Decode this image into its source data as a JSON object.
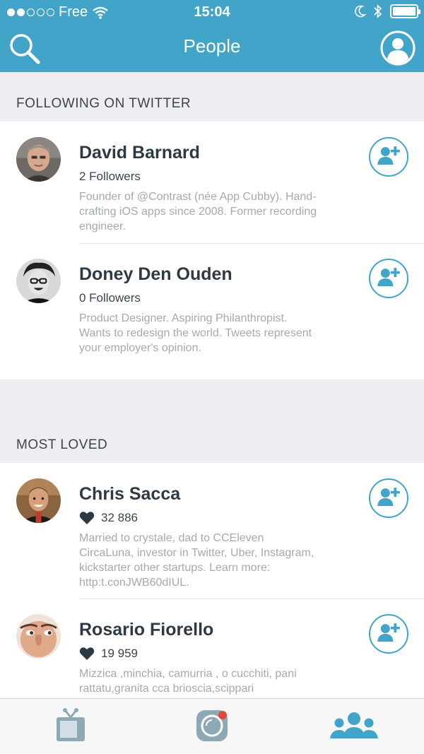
{
  "status_bar": {
    "carrier": "Free",
    "time": "15:04",
    "battery_level": 1.0
  },
  "nav": {
    "title": "People",
    "search_icon": "search-icon",
    "profile_icon": "profile-icon"
  },
  "colors": {
    "accent": "#42a4c8",
    "text_dark": "#2d3a44",
    "text_muted": "#a3aab1",
    "section_bg": "#eeeef2"
  },
  "sections": [
    {
      "title": "FOLLOWING ON TWITTER"
    },
    {
      "title": "MOST LOVED"
    }
  ],
  "following": [
    {
      "name": "David Barnard",
      "meta": "2 Followers",
      "bio": "Founder of @Contrast (née App Cubby). Hand-crafting iOS apps since 2008. Former recording engineer."
    },
    {
      "name": "Doney Den Ouden",
      "meta": "0 Followers",
      "bio": "Product Designer. Aspiring Philanthropist. Wants to redesign the world. Tweets represent your employer's opinion."
    }
  ],
  "loved": [
    {
      "name": "Chris Sacca",
      "likes": "32 886",
      "bio": "Married to crystale, dad to CCEleven CircaLuna, investor in Twitter, Uber, Instagram, kickstarter  other startups. Learn more: http:t.conJWB60dIUL."
    },
    {
      "name": "Rosario Fiorello",
      "likes": "19 959",
      "bio": "Mizzica ,minchia, camurria , o cucchiti, pani rattatu,granita cca brioscia,scippari"
    }
  ],
  "tabs": [
    {
      "icon": "tv-icon",
      "active": false
    },
    {
      "icon": "camera-icon",
      "active": false
    },
    {
      "icon": "people-icon",
      "active": true
    }
  ]
}
